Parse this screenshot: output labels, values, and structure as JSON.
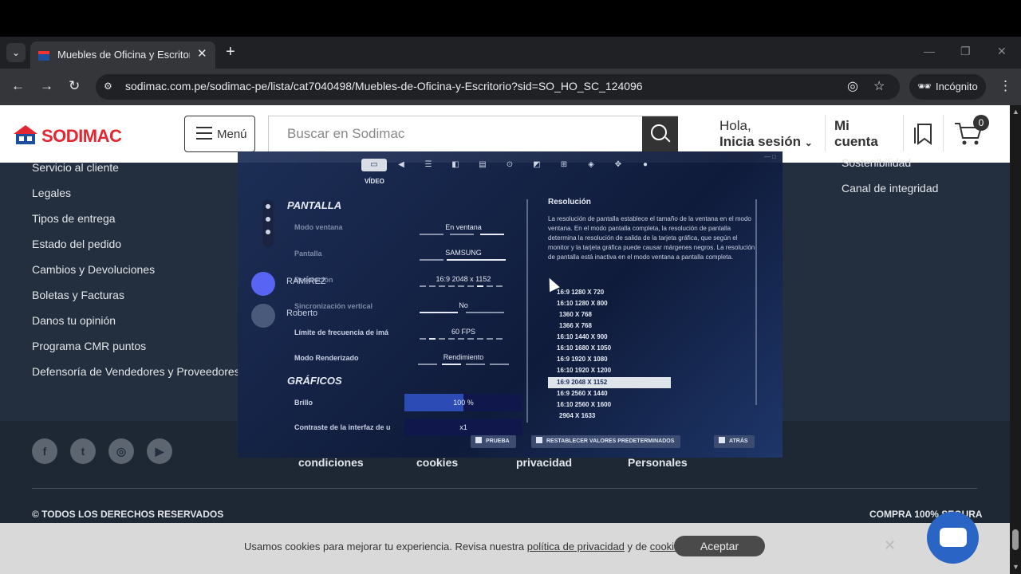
{
  "browser": {
    "tab_title": "Muebles de Oficina y Escritorio",
    "url": "sodimac.com.pe/sodimac-pe/lista/cat7040498/Muebles-de-Oficina-y-Escritorio?sid=SO_HO_SC_124096",
    "incognito_label": "Incógnito",
    "icons": [
      "chevron-down-icon",
      "close-icon",
      "plus-icon",
      "minimize-icon",
      "restore-icon",
      "back-icon",
      "forward-icon",
      "reload-icon",
      "site-settings-icon",
      "eye-off-icon",
      "star-icon",
      "incognito-icon",
      "kebab-menu-icon"
    ]
  },
  "header": {
    "logo_text": "SODIMAC",
    "menu_label": "Menú",
    "search_placeholder": "Buscar en Sodimac",
    "greeting_line1": "Hola,",
    "greeting_line2": "Inicia sesión",
    "account_line1": "Mi",
    "account_line2": "cuenta",
    "cart_count": "0",
    "brand_color": "#e3262f"
  },
  "footer": {
    "links": [
      "Servicio al cliente",
      "Legales",
      "Tipos de entrega",
      "Estado del pedido",
      "Cambios y Devoluciones",
      "Boletas y Facturas",
      "Danos tu opinión",
      "Programa CMR puntos",
      "Defensoría de Vendedores y Proveedores"
    ],
    "right_links": [
      "Sostenibilidad",
      "Canal de integridad"
    ],
    "social": [
      "facebook-icon",
      "twitter-icon",
      "instagram-icon",
      "youtube-icon"
    ],
    "legal_links": [
      "condiciones",
      "cookies",
      "privacidad",
      "Personales"
    ],
    "copyright": "© TODOS LOS DERECHOS RESERVADOS",
    "secure": "COMPRA 100% SEGURA"
  },
  "cookie_bar": {
    "text_before": "Usamos cookies para mejorar tu experiencia. Revisa nuestra ",
    "privacy_link": "política de privacidad",
    "text_mid": " y de ",
    "cookies_link": "cookies",
    "accept_label": "Aceptar"
  },
  "game_overlay": {
    "active_tab": "VÍDEO",
    "sections": {
      "screen": "PANTALLA",
      "graphics": "GRÁFICOS"
    },
    "settings": [
      {
        "label": "Modo ventana",
        "value": "En ventana"
      },
      {
        "label": "Pantalla",
        "value": "SAMSUNG"
      },
      {
        "label": "Resolución",
        "value": "16:9 2048 x 1152"
      },
      {
        "label": "Sincronización vertical",
        "value": "No"
      },
      {
        "label": "Límite de frecuencia de imá",
        "value": "60 FPS"
      },
      {
        "label": "Modo Renderizado",
        "value": "Rendimiento"
      }
    ],
    "graphics": [
      {
        "label": "Brillo",
        "value": "100 %",
        "fill": 0.5
      },
      {
        "label": "Contraste de la interfaz de u",
        "value": "x1",
        "fill": 0
      }
    ],
    "resolution_title": "Resolución",
    "resolution_desc": "La resolución de pantalla establece el tamaño de la ventana en el modo ventana. En el modo pantalla completa, la resolución de pantalla determina la resolución de salida de la tarjeta gráfica, que según el monitor y la tarjeta gráfica puede causar márgenes negros. La resolución de pantalla está inactiva en el modo ventana a pantalla completa.",
    "resolutions": [
      "16:9 1280 X 720",
      "16:10 1280 X 800",
      "1360 X 768",
      "1366 X 768",
      "16:10 1440 X 900",
      "16:10 1680 X 1050",
      "16:9 1920 X 1080",
      "16:10 1920 X 1200",
      "16:9 2048 X 1152",
      "16:9 2560 X 1440",
      "16:10 2560 X 1600",
      "2904 X 1633"
    ],
    "selected_resolution_index": 8,
    "discord": [
      {
        "name": "RAMÍREZ"
      },
      {
        "name": "Roberto"
      }
    ],
    "footer_buttons": [
      "PRUEBA",
      "RESTABLECER VALORES PREDETERMINADOS",
      "ATRÁS"
    ]
  }
}
